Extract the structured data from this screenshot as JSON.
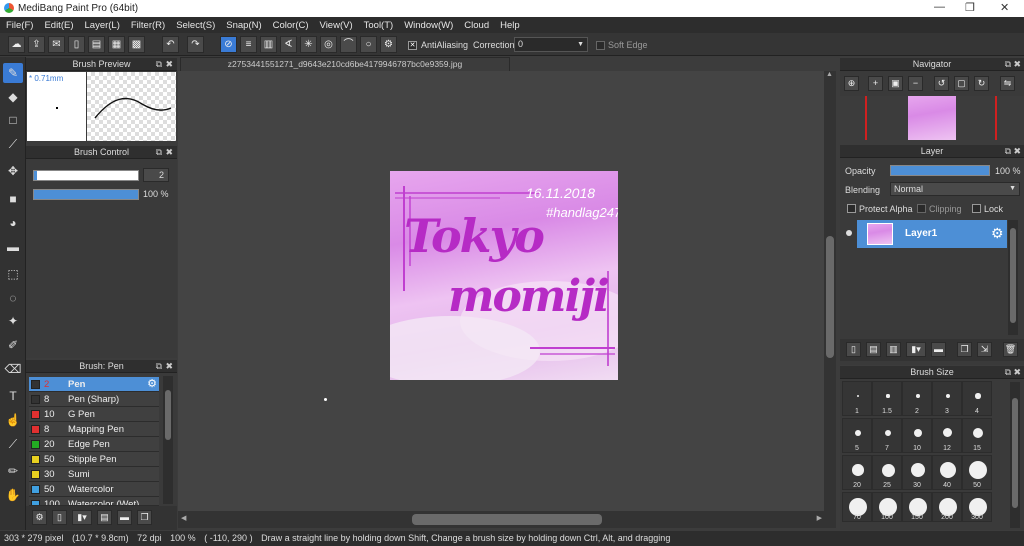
{
  "app": {
    "title": "MediBang Paint Pro (64bit)"
  },
  "menu": [
    "File(F)",
    "Edit(E)",
    "Layer(L)",
    "Filter(R)",
    "Select(S)",
    "Snap(N)",
    "Color(C)",
    "View(V)",
    "Tool(T)",
    "Window(W)",
    "Cloud",
    "Help"
  ],
  "toolbar": {
    "antialiasing_label": "AntiAliasing",
    "correction_label": "Correction",
    "correction_value": "0",
    "soft_edge_label": "Soft Edge"
  },
  "brush_preview": {
    "title": "Brush Preview",
    "size_label": "* 0.71mm"
  },
  "brush_control": {
    "title": "Brush Control",
    "size_value": "2",
    "opacity_value": "100 %"
  },
  "doc_tab": {
    "filename": "z2753441551271_d9643e210cd6be4179946787bc0e9359.jpg"
  },
  "artwork": {
    "line1": "Tokyo",
    "line2": "momiji",
    "date": "16.11.2018",
    "tag": "#handlag247"
  },
  "brush_list": {
    "title": "Brush: Pen",
    "items": [
      {
        "size": "2",
        "name": "Pen",
        "color": "#333333",
        "selected": true
      },
      {
        "size": "8",
        "name": "Pen (Sharp)",
        "color": "#333333"
      },
      {
        "size": "10",
        "name": "G Pen",
        "color": "#e03030"
      },
      {
        "size": "8",
        "name": "Mapping Pen",
        "color": "#e03030"
      },
      {
        "size": "20",
        "name": "Edge Pen",
        "color": "#22aa22"
      },
      {
        "size": "50",
        "name": "Stipple Pen",
        "color": "#e8d020"
      },
      {
        "size": "30",
        "name": "Sumi",
        "color": "#e8d020"
      },
      {
        "size": "50",
        "name": "Watercolor",
        "color": "#40a0e0"
      },
      {
        "size": "100",
        "name": "Watercolor (Wet)",
        "color": "#40a0e0"
      }
    ]
  },
  "navigator": {
    "title": "Navigator"
  },
  "layer": {
    "title": "Layer",
    "opacity_label": "Opacity",
    "opacity_value": "100 %",
    "blending_label": "Blending",
    "blending_value": "Normal",
    "protect_alpha_label": "Protect Alpha",
    "clipping_label": "Clipping",
    "lock_label": "Lock",
    "layer_name": "Layer1"
  },
  "brush_size": {
    "title": "Brush Size",
    "sizes": [
      "1",
      "1.5",
      "2",
      "3",
      "4",
      "5",
      "7",
      "10",
      "12",
      "15",
      "20",
      "25",
      "30",
      "40",
      "50",
      "70",
      "100",
      "150",
      "200",
      "300"
    ]
  },
  "status": {
    "pixel": "303 * 279 pixel",
    "cm": "(10.7 * 9.8cm)",
    "dpi": "72 dpi",
    "zoom": "100 %",
    "coords": "( -110, 290 )",
    "hint": "Draw a straight line by holding down Shift, Change a brush size by holding down Ctrl, Alt, and dragging"
  },
  "colors": {
    "accent": "#3a7bd5",
    "layer_selected": "#4d8fd6"
  }
}
